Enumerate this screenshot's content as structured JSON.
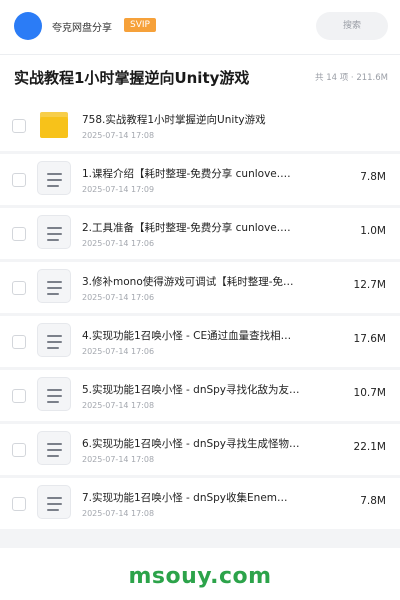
{
  "topbar": {
    "user_name": "夸克网盘分享",
    "badge": "SVIP",
    "search_placeholder": "搜索",
    "accent": "#2b7cf6",
    "badge_color": "#f6a13a"
  },
  "header": {
    "title": "实战教程1小时掌握逆向Unity游戏",
    "summary": "共 14 项 · 211.6M"
  },
  "files": [
    {
      "type": "folder",
      "name": "758.实战教程1小时掌握逆向Unity游戏",
      "date": "2025-07-14 17:08",
      "size": ""
    },
    {
      "type": "doc",
      "name": "1.课程介绍【耗时整理-免费分享 cunlove.…",
      "date": "2025-07-14 17:09",
      "size": "7.8M"
    },
    {
      "type": "doc",
      "name": "2.工具准备【耗时整理-免费分享 cunlove.…",
      "date": "2025-07-14 17:06",
      "size": "1.0M"
    },
    {
      "type": "doc",
      "name": "3.修补mono使得游戏可调试【耗时整理-免费分享…",
      "date": "2025-07-14 17:06",
      "size": "12.7M"
    },
    {
      "type": "doc",
      "name": "4.实现功能1召唤小怪 - CE通过血量查找相关类…",
      "date": "2025-07-14 17:06",
      "size": "17.6M"
    },
    {
      "type": "doc",
      "name": "5.实现功能1召唤小怪 - dnSpy寻找化敌为友…",
      "date": "2025-07-14 17:08",
      "size": "10.7M"
    },
    {
      "type": "doc",
      "name": "6.实现功能1召唤小怪 - dnSpy寻找生成怪物…",
      "date": "2025-07-14 17:08",
      "size": "22.1M"
    },
    {
      "type": "doc",
      "name": "7.实现功能1召唤小怪 - dnSpy收集Enem…",
      "date": "2025-07-14 17:08",
      "size": "7.8M"
    }
  ],
  "footer": {
    "watermark": "msouy.com",
    "watermark_color": "#2ca34a"
  }
}
